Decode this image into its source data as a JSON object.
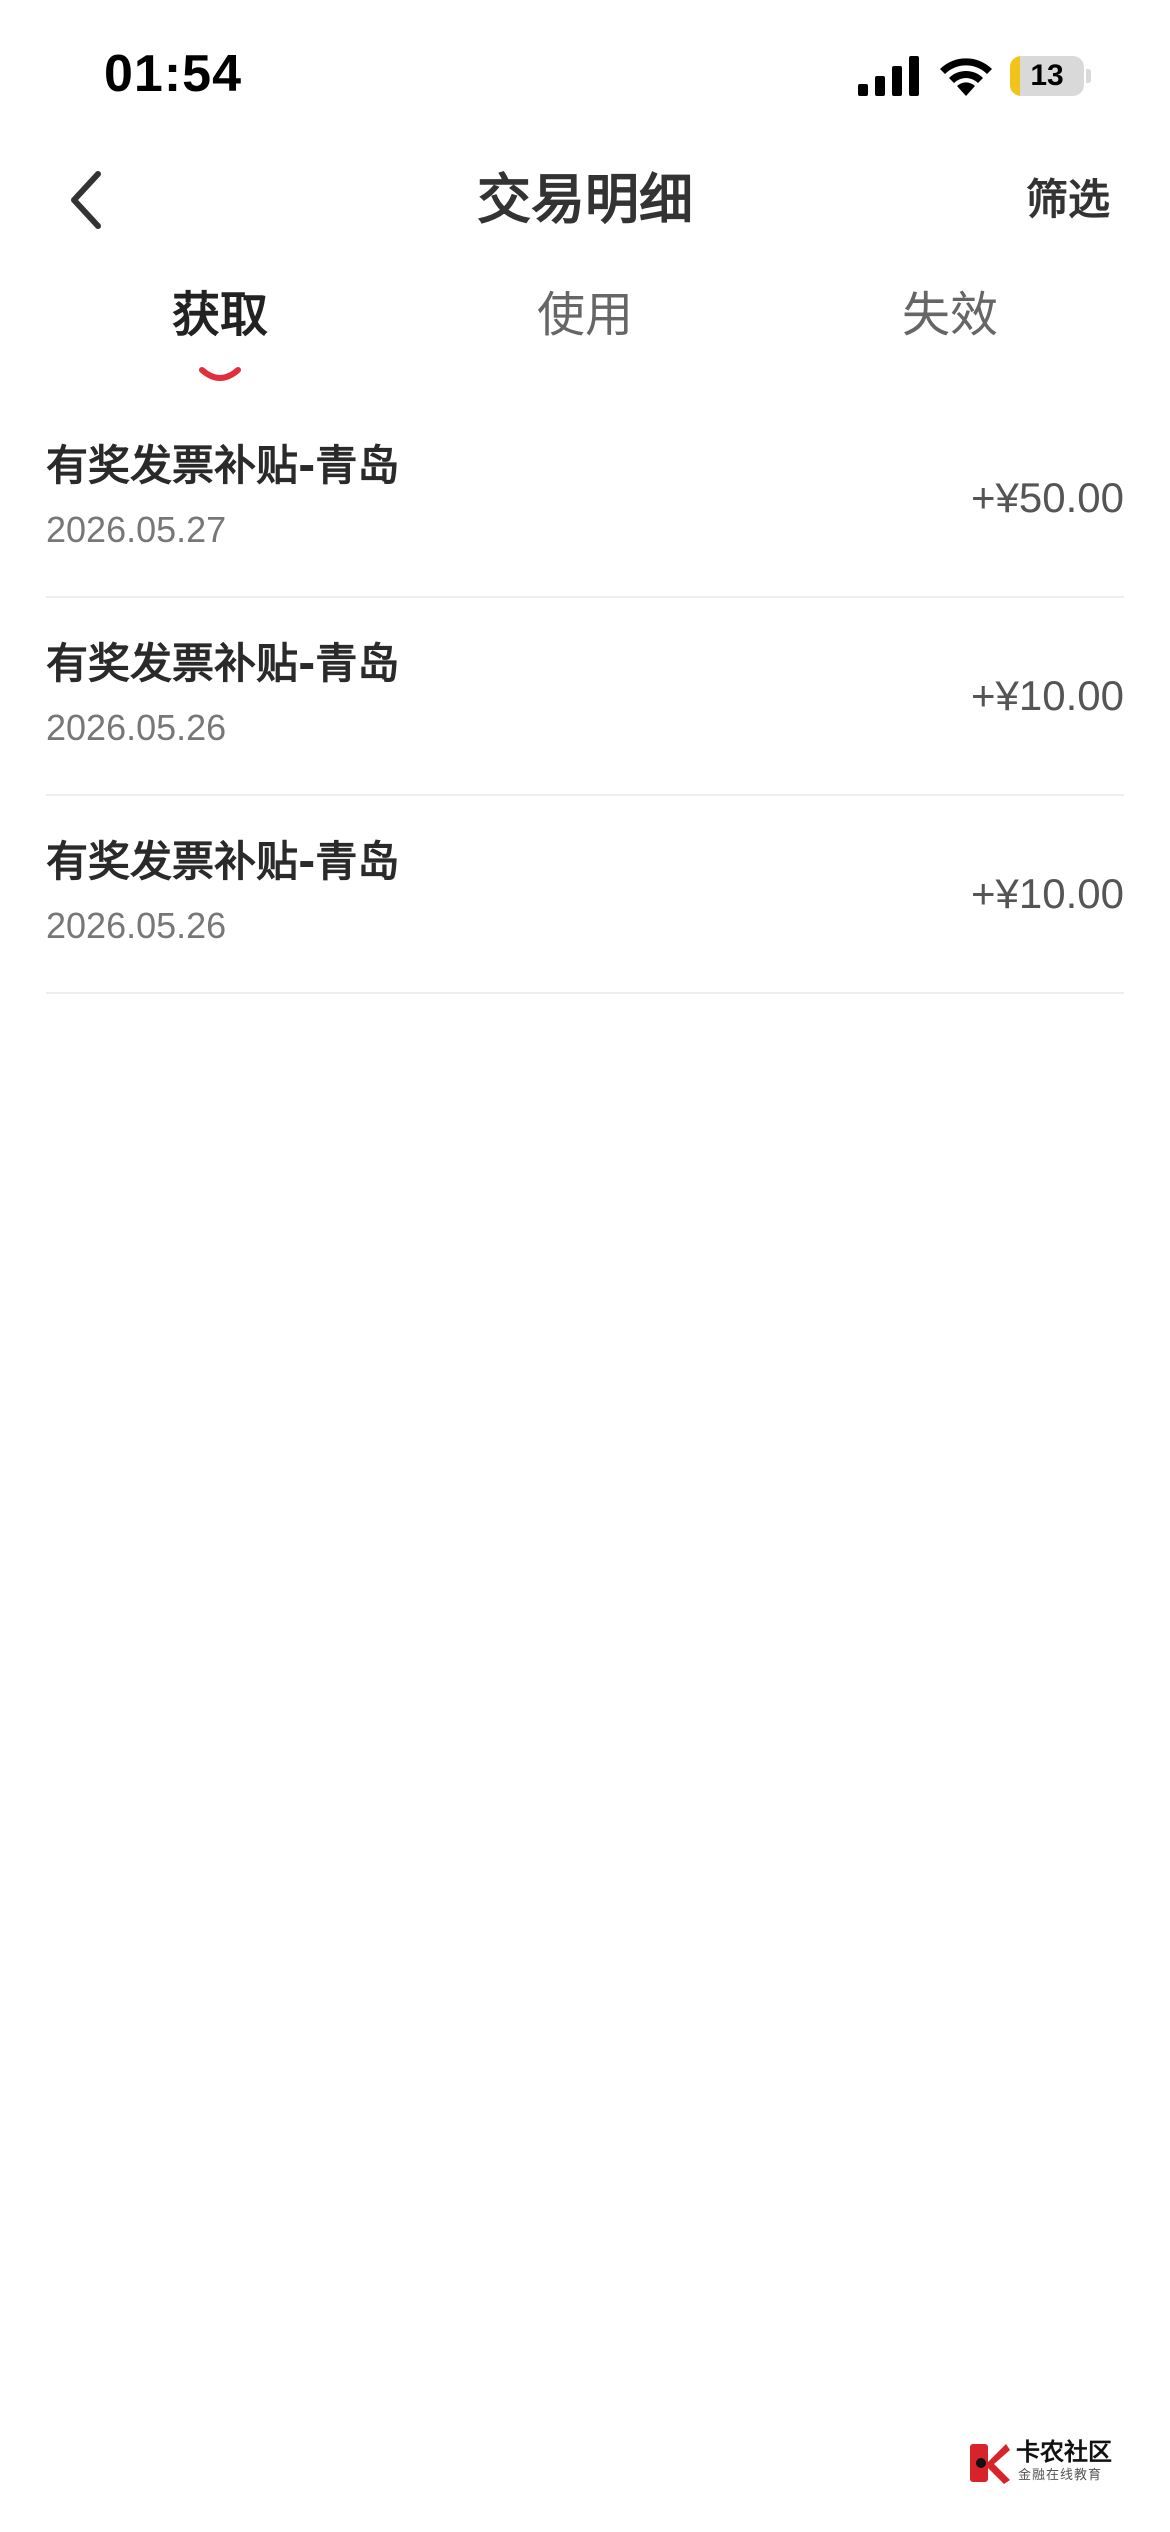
{
  "status_bar": {
    "time": "01:54",
    "battery_percent": "13",
    "battery_level": 0.13
  },
  "header": {
    "title": "交易明细",
    "filter_label": "筛选"
  },
  "tabs": [
    {
      "label": "获取",
      "active": true
    },
    {
      "label": "使用",
      "active": false
    },
    {
      "label": "失效",
      "active": false
    }
  ],
  "transactions": [
    {
      "title": "有奖发票补贴-青岛",
      "date": "2026.05.27",
      "amount": "+¥50.00"
    },
    {
      "title": "有奖发票补贴-青岛",
      "date": "2026.05.26",
      "amount": "+¥10.00"
    },
    {
      "title": "有奖发票补贴-青岛",
      "date": "2026.05.26",
      "amount": "+¥10.00"
    }
  ],
  "watermark": {
    "title": "卡农社区",
    "subtitle": "金融在线教育"
  },
  "colors": {
    "accent": "#e02e3c",
    "battery_fill": "#f2c41a",
    "divider": "#eeeeee"
  }
}
